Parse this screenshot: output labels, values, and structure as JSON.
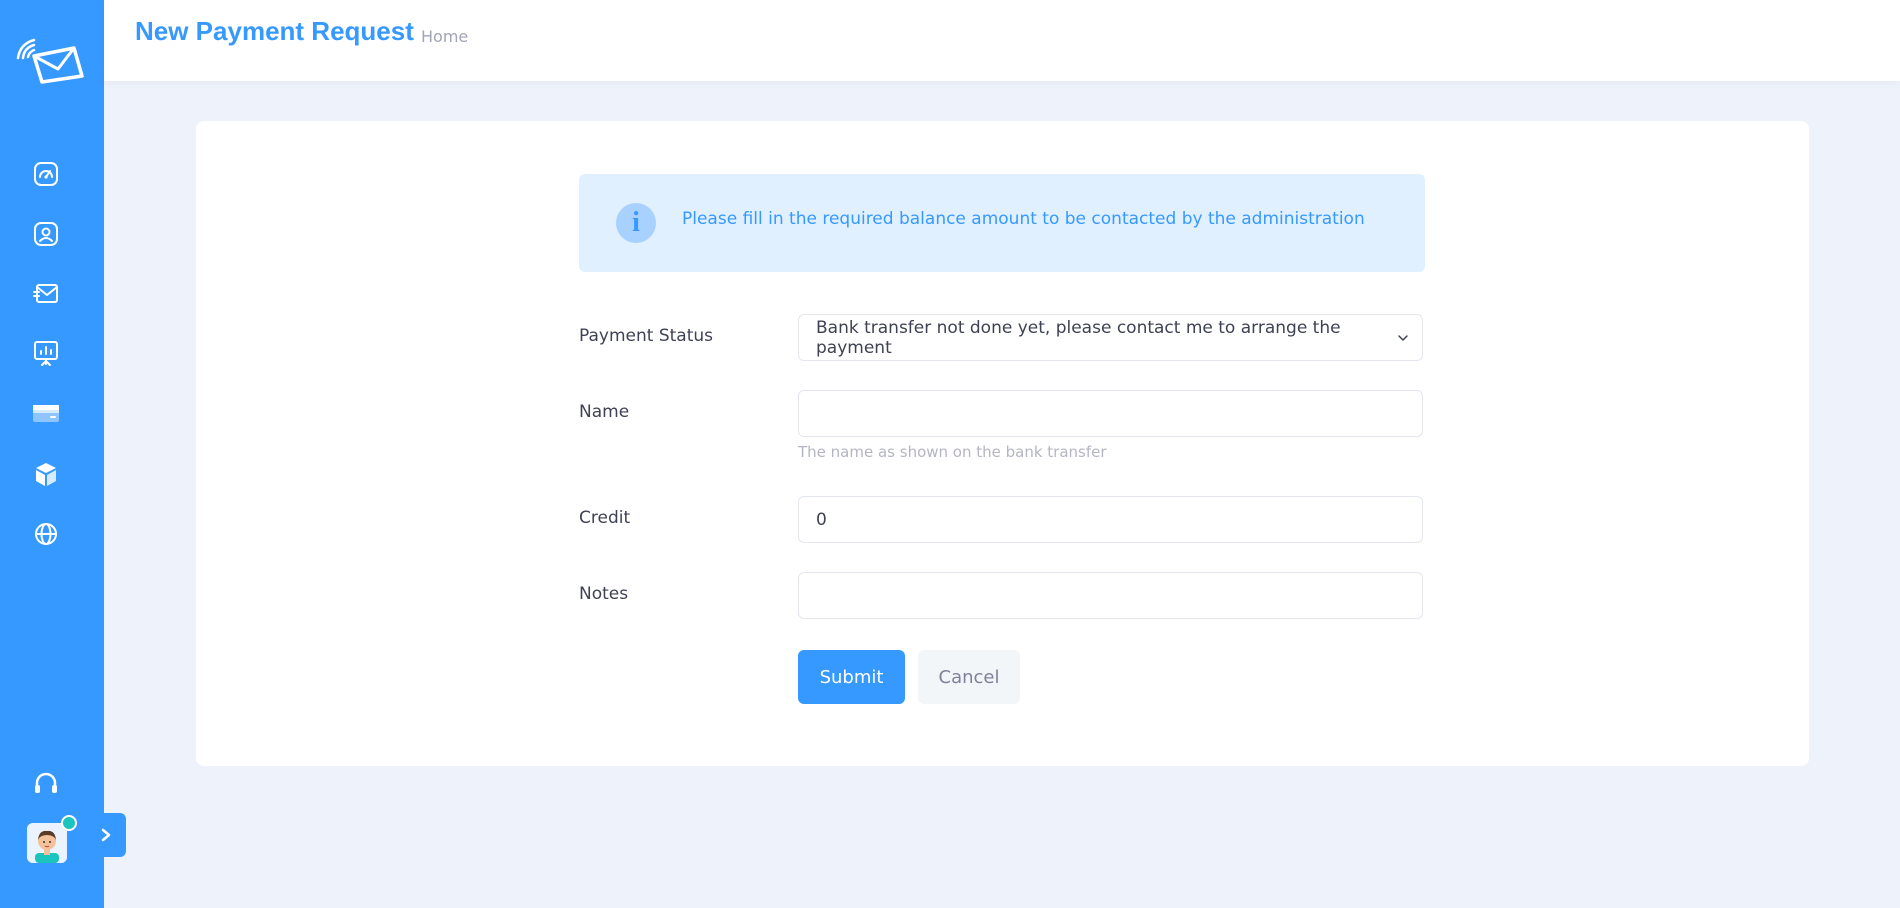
{
  "header": {
    "title": "New Payment Request",
    "breadcrumb": "Home"
  },
  "sidebar": {
    "items": [
      {
        "icon": "dashboard-gauge-icon"
      },
      {
        "icon": "user-profile-icon"
      },
      {
        "icon": "messages-icon"
      },
      {
        "icon": "presentation-chart-icon"
      },
      {
        "icon": "credit-card-icon"
      },
      {
        "icon": "package-box-icon"
      },
      {
        "icon": "globe-icon"
      }
    ],
    "support_icon": "headphones-icon",
    "user_status": "online"
  },
  "alert": {
    "text": "Please fill in the required balance amount to be contacted by the administration"
  },
  "form": {
    "payment_status": {
      "label": "Payment Status",
      "value": "Bank transfer not done yet, please contact me to arrange the payment"
    },
    "name": {
      "label": "Name",
      "value": "",
      "hint": "The name as shown on the bank transfer"
    },
    "credit": {
      "label": "Credit",
      "value": "0"
    },
    "notes": {
      "label": "Notes",
      "value": ""
    },
    "submit_label": "Submit",
    "cancel_label": "Cancel"
  },
  "colors": {
    "primary": "#3699ff",
    "alert_bg": "#e1f0ff",
    "page_bg": "#eef3fb",
    "online": "#1bc5bd"
  }
}
